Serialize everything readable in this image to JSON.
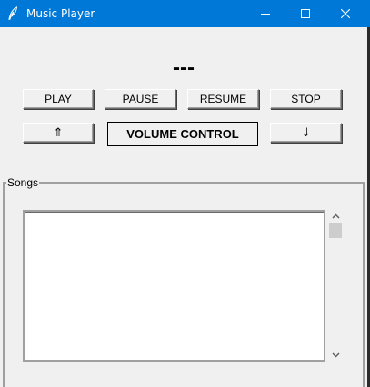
{
  "window": {
    "title": "Music Player",
    "icon": "feather-icon",
    "controls": [
      "minimize-icon",
      "maximize-icon",
      "close-icon"
    ],
    "accent_color": "#0078d7"
  },
  "status": {
    "text": "---"
  },
  "controls": {
    "play_label": "PLAY",
    "pause_label": "PAUSE",
    "resume_label": "RESUME",
    "stop_label": "STOP",
    "volume_up_label": "⇑",
    "volume_label": "VOLUME CONTROL",
    "volume_down_label": "⇓"
  },
  "songs": {
    "frame_label": "Songs",
    "items": []
  }
}
